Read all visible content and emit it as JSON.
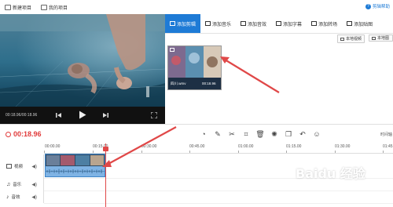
{
  "topbar": {
    "new_project": "新建项目",
    "my_projects": "我的项目",
    "help": "剪辑帮助"
  },
  "player": {
    "time_display": "00:18.96/00:18.96",
    "volume_label": "一以"
  },
  "tabs": [
    {
      "label": "添加剪辑",
      "icon": "clip-icon"
    },
    {
      "label": "添加音乐",
      "icon": "music-icon"
    },
    {
      "label": "添加音效",
      "icon": "sound-effect-icon"
    },
    {
      "label": "添加字幕",
      "icon": "subtitle-icon"
    },
    {
      "label": "添加转场",
      "icon": "transition-icon"
    },
    {
      "label": "添加贴图",
      "icon": "sticker-icon"
    }
  ],
  "library": {
    "local_video": "本地视频",
    "local_image": "本地图",
    "thumb_name": "四川.wmv",
    "thumb_duration": "00:18.96"
  },
  "toolbar": {
    "current_time": "00:18.96",
    "zoom_label": "时间轴"
  },
  "ruler": [
    "00:00.00",
    "00:15.00",
    "00:30.00",
    "00:45.00",
    "01:00.00",
    "01:15.00",
    "01:30.00",
    "01:45"
  ],
  "tracks": [
    {
      "label": "视频",
      "icon": "video-track-icon"
    },
    {
      "label": "音乐",
      "icon": "music-track-icon"
    },
    {
      "label": "音效",
      "icon": "sound-track-icon"
    }
  ],
  "colors": {
    "accent": "#1e7bd6",
    "timecode": "#e13a3a",
    "arrow": "#e04848"
  },
  "watermark": "Baidu 经验"
}
